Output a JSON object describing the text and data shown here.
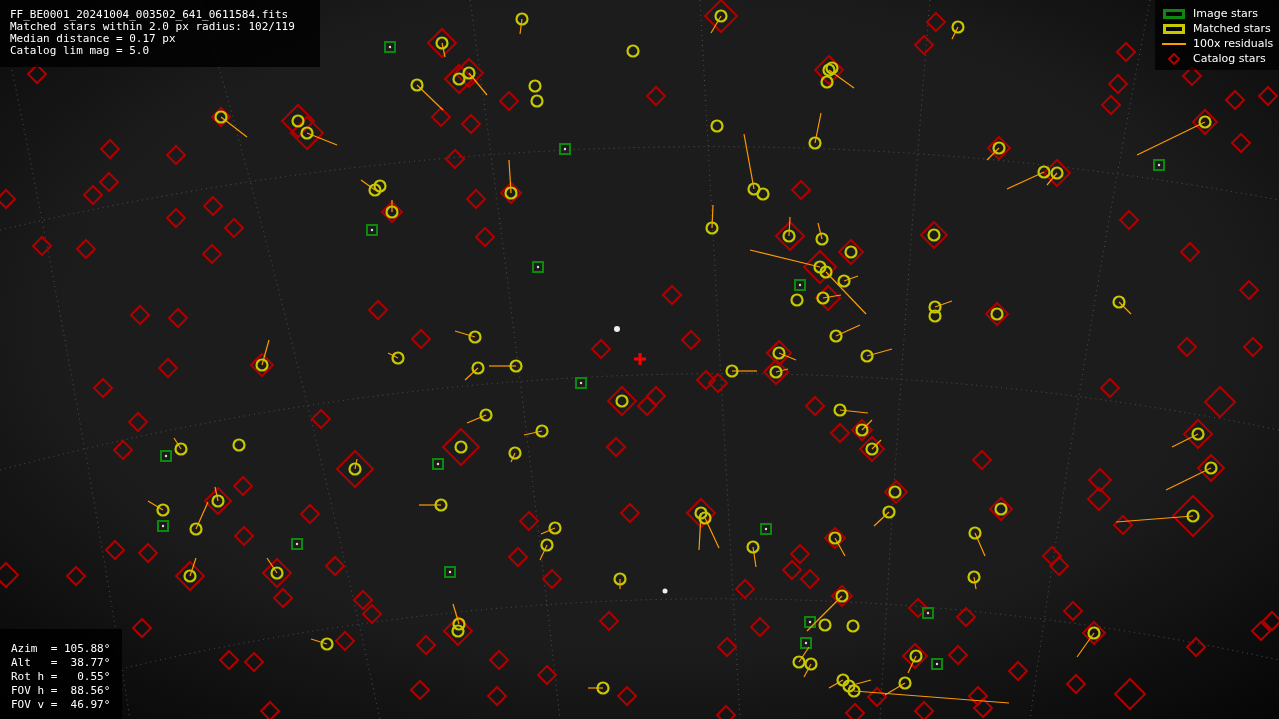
{
  "file_info": {
    "lines": [
      "FF_BE0001_20241004_003502_641_0611584.fits",
      "Matched stars within 2.0 px radius: 102/119",
      "Median distance = 0.17 px",
      "Catalog lim mag = 5.0"
    ]
  },
  "legend": {
    "items": [
      {
        "label": "Image stars",
        "kind": "box",
        "color": "#0d8a0d"
      },
      {
        "label": "Matched stars",
        "kind": "box",
        "color": "#c8c800"
      },
      {
        "label": "100x residuals",
        "kind": "line",
        "color": "#ff9900"
      },
      {
        "label": "Catalog stars",
        "kind": "diamond",
        "color": "#b00000"
      }
    ]
  },
  "pointing_info": {
    "lines": [
      "Azim  = 105.88°",
      "Alt   =  38.77°",
      "Rot h =   0.55°",
      "FOV h =  88.56°",
      "FOV v =  46.97°"
    ]
  }
}
